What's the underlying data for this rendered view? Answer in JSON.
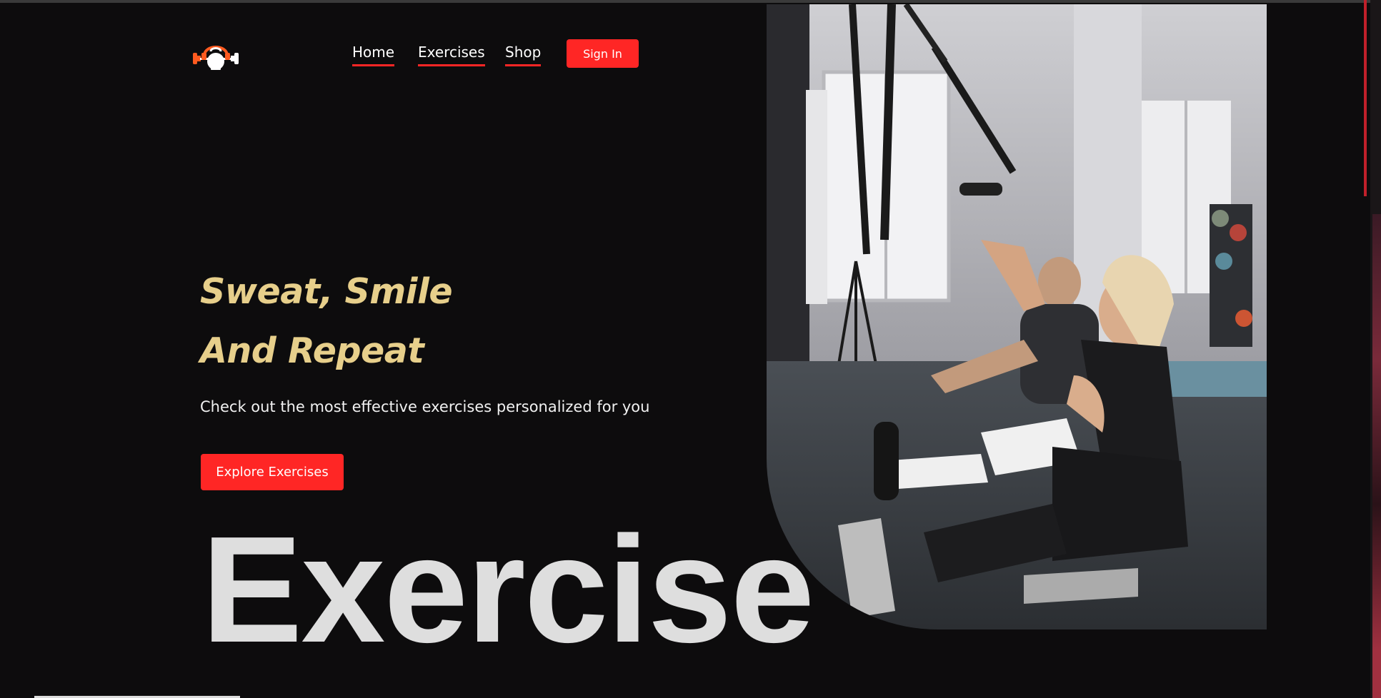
{
  "nav": {
    "home_label": "Home",
    "exercises_label": "Exercises",
    "shop_label": "Shop",
    "signin_label": "Sign In"
  },
  "hero": {
    "title_line1": "Sweat, Smile",
    "title_line2": "And Repeat",
    "subtitle": "Check out the most effective exercises personalized for you",
    "cta_label": "Explore Exercises",
    "big_word": "Exercise"
  },
  "icons": {
    "logo": "kettlebell-logo-icon"
  },
  "colors": {
    "accent": "#ff2625",
    "title_gold": "#e7cf8b",
    "background": "#0d0c0d"
  }
}
